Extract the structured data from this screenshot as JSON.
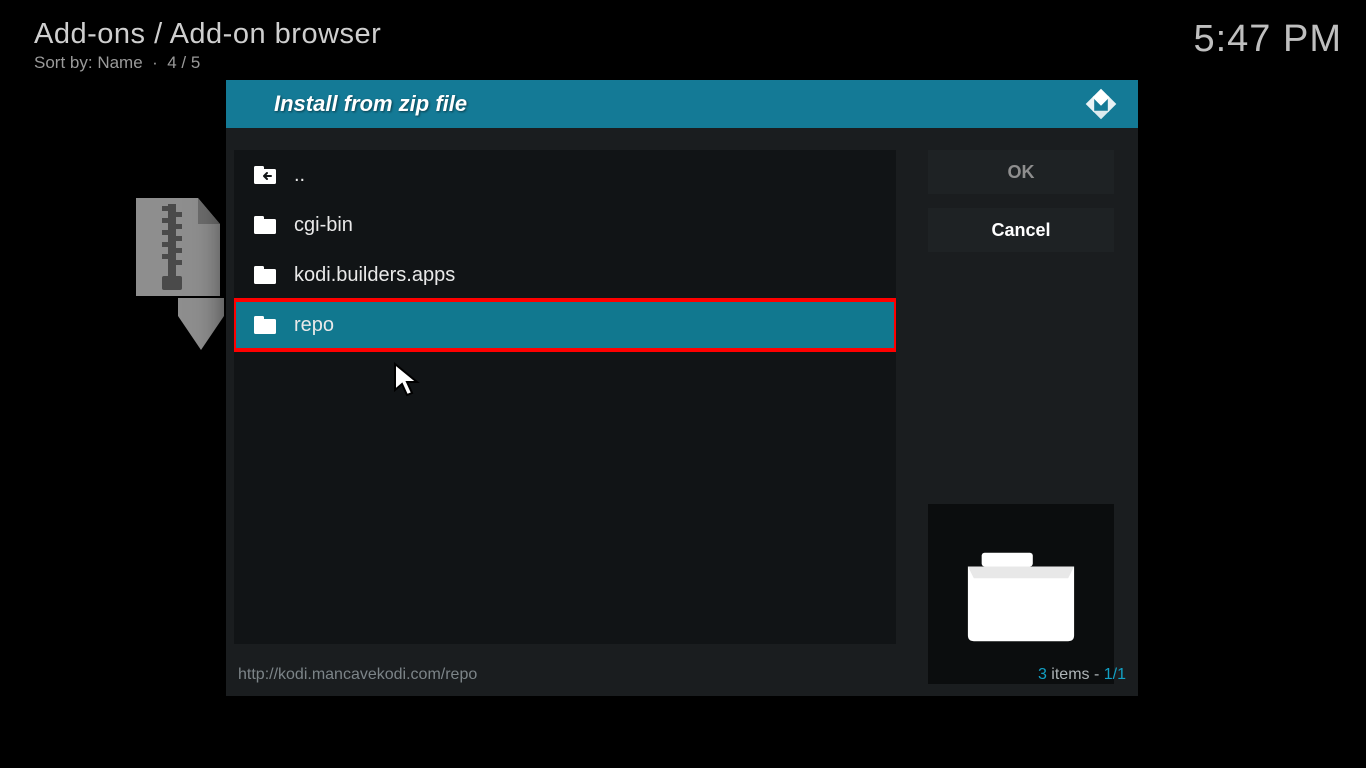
{
  "header": {
    "breadcrumb": "Add-ons / Add-on browser",
    "sort_prefix": "Sort by: ",
    "sort_value": "Name",
    "position": "4 / 5",
    "clock": "5:47 PM"
  },
  "dialog": {
    "title": "Install from zip file",
    "path": "http://kodi.mancavekodi.com/repo",
    "item_count": "3",
    "items_label": " items - ",
    "page": "1/1",
    "ok_label": "OK",
    "cancel_label": "Cancel",
    "rows": [
      {
        "icon": "back",
        "label": "..",
        "selected": false,
        "highlight": false
      },
      {
        "icon": "folder",
        "label": "cgi-bin",
        "selected": false,
        "highlight": false
      },
      {
        "icon": "folder",
        "label": "kodi.builders.apps",
        "selected": false,
        "highlight": false
      },
      {
        "icon": "folder",
        "label": "repo",
        "selected": true,
        "highlight": true
      }
    ]
  }
}
